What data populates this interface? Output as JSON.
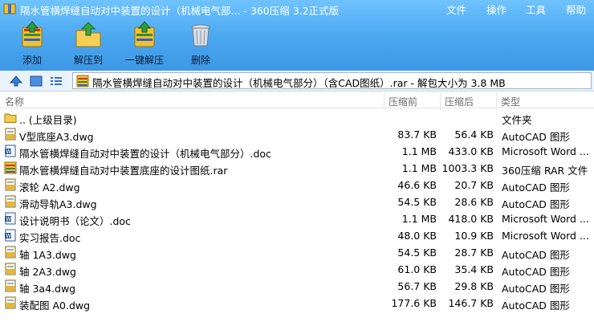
{
  "window": {
    "title": "隔水管横焊缝自动对中装置的设计（机械电气部... - 360压缩 3.2正式版",
    "menu": [
      "文件",
      "操作",
      "工具",
      "帮助"
    ]
  },
  "toolbar": {
    "add_label": "添加",
    "extract_label": "解压到",
    "oneclick_label": "一键解压",
    "delete_label": "删除"
  },
  "address": {
    "path": "隔水管横焊缝自动对中装置的设计（机械电气部分）（含CAD图纸）.rar - 解包大小为 3.8 MB"
  },
  "columns": {
    "name": "名称",
    "packed": "压缩前",
    "size": "压缩后",
    "type": "类型"
  },
  "files": [
    {
      "name": ".. (上级目录)",
      "packed": "",
      "size": "",
      "type": "文件夹",
      "icon": "folder-icon"
    },
    {
      "name": "V型底座A3.dwg",
      "packed": "83.7 KB",
      "size": "56.4 KB",
      "type": "AutoCAD 图形",
      "icon": "dwg-icon"
    },
    {
      "name": "隔水管横焊缝自动对中装置的设计（机械电气部分）.doc",
      "packed": "1.1 MB",
      "size": "433.0 KB",
      "type": "Microsoft Word ...",
      "icon": "word-icon"
    },
    {
      "name": "隔水管横焊缝自动对中装置底座的设计图纸.rar",
      "packed": "1.1 MB",
      "size": "1003.3 KB",
      "type": "360压缩 RAR 文件",
      "icon": "rar-icon"
    },
    {
      "name": "滚轮  A2.dwg",
      "packed": "46.6 KB",
      "size": "20.7 KB",
      "type": "AutoCAD 图形",
      "icon": "dwg-icon"
    },
    {
      "name": "滑动导轨A3.dwg",
      "packed": "54.5 KB",
      "size": "28.6 KB",
      "type": "AutoCAD 图形",
      "icon": "dwg-icon"
    },
    {
      "name": "设计说明书（论文）.doc",
      "packed": "1.1 MB",
      "size": "418.0 KB",
      "type": "Microsoft Word ...",
      "icon": "word-icon"
    },
    {
      "name": "实习报告.doc",
      "packed": "48.0 KB",
      "size": "10.9 KB",
      "type": "Microsoft Word ...",
      "icon": "word-icon"
    },
    {
      "name": "轴   1A3.dwg",
      "packed": "54.5 KB",
      "size": "28.7 KB",
      "type": "AutoCAD 图形",
      "icon": "dwg-icon"
    },
    {
      "name": "轴   2A3.dwg",
      "packed": "61.0 KB",
      "size": "35.4 KB",
      "type": "AutoCAD 图形",
      "icon": "dwg-icon"
    },
    {
      "name": "轴   3a4.dwg",
      "packed": "56.7 KB",
      "size": "29.8 KB",
      "type": "AutoCAD 图形",
      "icon": "dwg-icon"
    },
    {
      "name": "装配图  A0.dwg",
      "packed": "177.6 KB",
      "size": "146.7 KB",
      "type": "AutoCAD 图形",
      "icon": "dwg-icon"
    }
  ]
}
